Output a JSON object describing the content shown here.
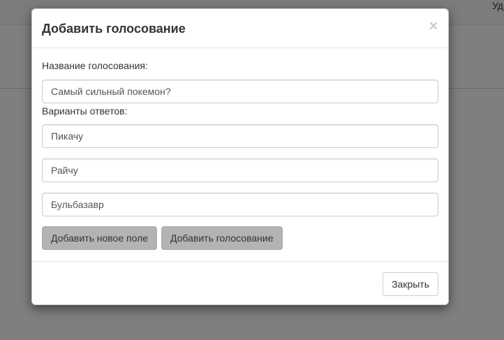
{
  "background": {
    "nav_partial_text": "Уд"
  },
  "modal": {
    "title": "Добавить голосование",
    "close_symbol": "×",
    "poll_name_label": "Название голосования:",
    "poll_name_value": "Самый сильный покемон?",
    "options_label": "Варианты ответов:",
    "options": [
      {
        "value": "Пикачу"
      },
      {
        "value": "Райчу"
      },
      {
        "value": "Бульбазавр"
      }
    ],
    "add_field_button": "Добавить новое поле",
    "add_poll_button": "Добавить голосование",
    "close_button": "Закрыть"
  }
}
